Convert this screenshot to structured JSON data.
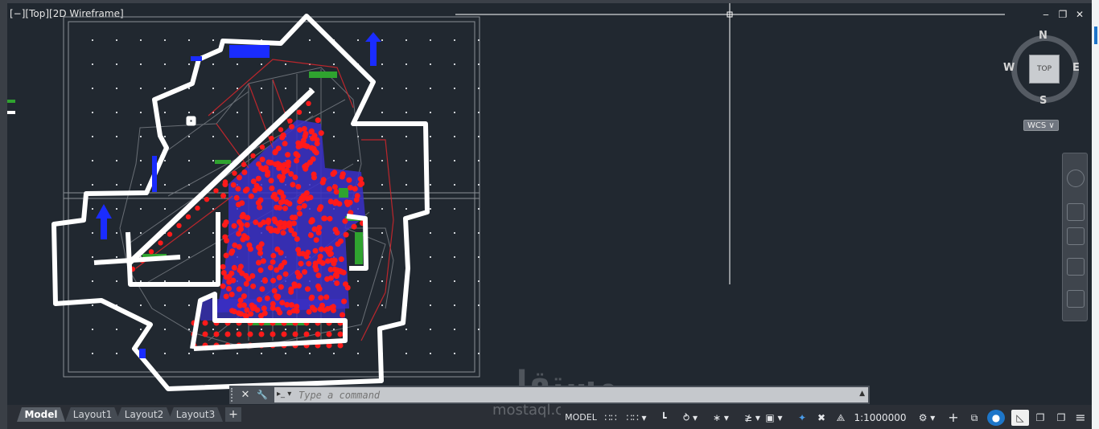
{
  "viewport": {
    "label": "[−][Top][2D Wireframe]"
  },
  "window_controls": {
    "minimize": "‒",
    "restore": "❐",
    "close": "✕"
  },
  "viewcube": {
    "north": "N",
    "south": "S",
    "east": "E",
    "west": "W",
    "face": "TOP",
    "ucs": "WCS ∨"
  },
  "command_line": {
    "placeholder": "Type a command",
    "close_icon": "✕",
    "settings_icon": "🔧",
    "prompt_icon": "▸_ ▾",
    "history_arrow": "▲"
  },
  "layout_tabs": {
    "items": [
      "Model",
      "Layout1",
      "Layout2",
      "Layout3"
    ],
    "active": "Model",
    "add": "+"
  },
  "status_bar": {
    "mode": "MODEL",
    "grid": "∷∷",
    "snap": "∷∷ ▾",
    "ortho": "┗",
    "polar": "⥁ ▾",
    "osnap": "∗ ▾",
    "lineweight": "≱ ▾",
    "selection": "▣ ▾",
    "annotation": "✦",
    "annotation2": "✖",
    "annotation3": "⟁",
    "scale": "1:1000000 ▾",
    "gear": "⚙ ▾",
    "plus": "+",
    "units": "⧉",
    "isolate": "●",
    "hardware": "◺",
    "clean": "❐",
    "customize": "≡"
  },
  "watermark": {
    "arabic": "مستقل",
    "latin": "mostaql.com"
  },
  "colors": {
    "background": "#212830",
    "boundary": "#ffffff",
    "points": "#ff1a1a",
    "hatch": "#3a2fc8",
    "arrows": "#1a2cff",
    "accent": "#1d76c9"
  }
}
